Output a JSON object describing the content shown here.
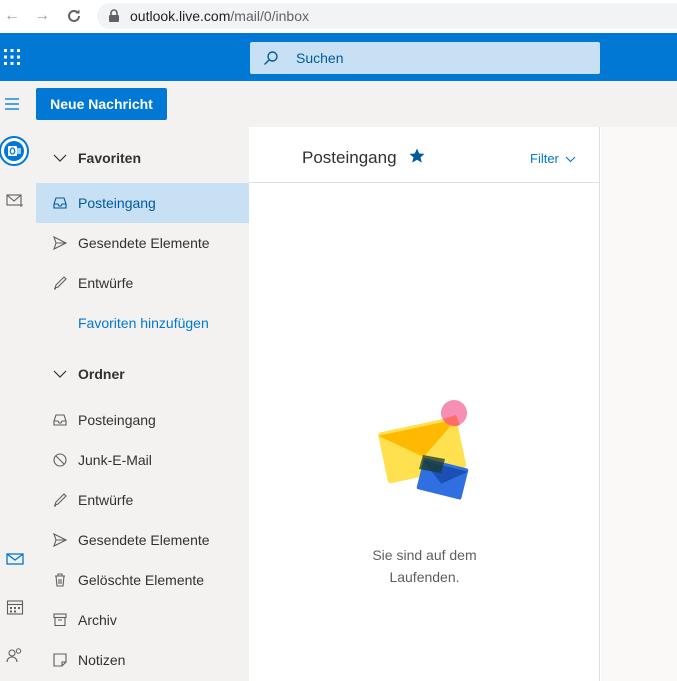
{
  "browser": {
    "url_host": "outlook.live.com",
    "url_path": "/mail/0/inbox"
  },
  "header": {
    "search_placeholder": "Suchen"
  },
  "command_bar": {
    "new_message_label": "Neue Nachricht"
  },
  "folder_pane": {
    "favorites_header": "Favoriten",
    "favorites": [
      {
        "label": "Posteingang",
        "icon": "inbox-icon",
        "selected": true
      },
      {
        "label": "Gesendete Elemente",
        "icon": "send-icon"
      },
      {
        "label": "Entwürfe",
        "icon": "pencil-icon"
      }
    ],
    "add_favorite_link": "Favoriten hinzufügen",
    "folders_header": "Ordner",
    "folders": [
      {
        "label": "Posteingang",
        "icon": "inbox-icon"
      },
      {
        "label": "Junk-E-Mail",
        "icon": "block-icon"
      },
      {
        "label": "Entwürfe",
        "icon": "pencil-icon"
      },
      {
        "label": "Gesendete Elemente",
        "icon": "send-icon"
      },
      {
        "label": "Gelöschte Elemente",
        "icon": "trash-icon"
      },
      {
        "label": "Archiv",
        "icon": "archive-icon"
      },
      {
        "label": "Notizen",
        "icon": "note-icon"
      }
    ]
  },
  "message_list": {
    "title": "Posteingang",
    "filter_label": "Filter",
    "empty_line1": "Sie sind auf dem",
    "empty_line2": "Laufenden."
  },
  "colors": {
    "brand": "#0078d4",
    "selected_bg": "#c7e0f4",
    "pane_bg": "#f3f2f1"
  }
}
